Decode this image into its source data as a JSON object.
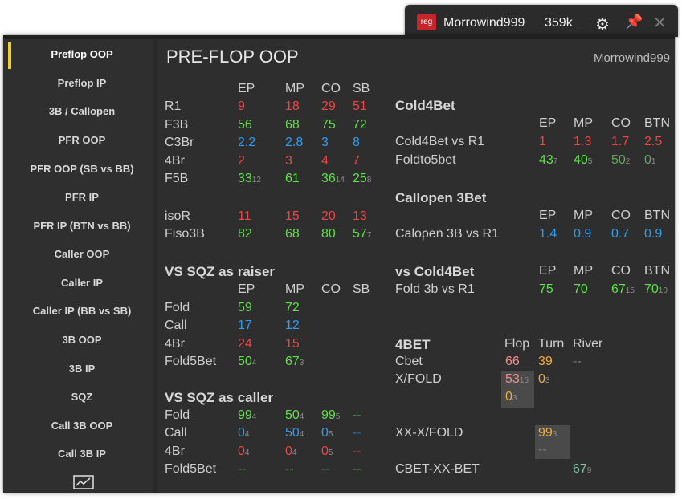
{
  "tab": {
    "logo": "reg",
    "user": "Morrowind999",
    "amount": "359k"
  },
  "sidebar": {
    "items": [
      "Preflop OOP",
      "Preflop IP",
      "3B / Callopen",
      "PFR OOP",
      "PFR OOP (SB vs BB)",
      "PFR IP",
      "PFR IP (BTN vs BB)",
      "Caller OOP",
      "Caller IP",
      "Caller IP (BB vs SB)",
      "3B OOP",
      "3B IP",
      "SQZ",
      "Call 3B OOP",
      "Call 3B IP"
    ]
  },
  "header": {
    "title": "PRE-FLOP OOP",
    "user_link": "Morrowind999"
  },
  "preflop": {
    "cols": [
      "EP",
      "MP",
      "CO",
      "SB"
    ],
    "rows": [
      {
        "label": "R1",
        "vals": [
          "9",
          "18",
          "29",
          "51"
        ]
      },
      {
        "label": "F3B",
        "vals": [
          "56",
          "68",
          "75",
          "72"
        ]
      },
      {
        "label": "C3Br",
        "vals": [
          "2.2",
          "2.8",
          "3",
          "8"
        ]
      },
      {
        "label": "4Br",
        "vals": [
          "2",
          "3",
          "4",
          "7"
        ]
      },
      {
        "label": "F5B",
        "vals": [
          "33",
          "61",
          "36",
          "25"
        ],
        "subs": [
          "12",
          "",
          "14",
          "8"
        ]
      },
      {
        "label": "isoR",
        "vals": [
          "11",
          "15",
          "20",
          "13"
        ]
      },
      {
        "label": "Fiso3B",
        "vals": [
          "82",
          "68",
          "80",
          "57"
        ],
        "subs": [
          "",
          "",
          "",
          "7"
        ]
      }
    ]
  },
  "sqz_raiser": {
    "title": "VS SQZ as raiser",
    "cols": [
      "EP",
      "MP",
      "CO",
      "SB"
    ],
    "rows": [
      {
        "label": "Fold",
        "vals": [
          "59",
          "72"
        ]
      },
      {
        "label": "Call",
        "vals": [
          "17",
          "12"
        ]
      },
      {
        "label": "4Br",
        "vals": [
          "24",
          "15"
        ]
      },
      {
        "label": "Fold5Bet",
        "vals": [
          "50",
          "67"
        ],
        "subs": [
          "4",
          "3"
        ]
      }
    ]
  },
  "sqz_caller": {
    "title": "VS SQZ as caller",
    "rows": [
      {
        "label": "Fold",
        "vals": [
          "99",
          "50",
          "99",
          "--"
        ],
        "subs": [
          "4",
          "4",
          "5",
          ""
        ]
      },
      {
        "label": "Call",
        "vals": [
          "0",
          "50",
          "0",
          "--"
        ],
        "subs": [
          "4",
          "4",
          "5",
          ""
        ]
      },
      {
        "label": "4Br",
        "vals": [
          "0",
          "0",
          "0",
          "--"
        ],
        "subs": [
          "4",
          "4",
          "5",
          ""
        ]
      },
      {
        "label": "Fold5Bet",
        "vals": [
          "--",
          "--",
          "--",
          "--"
        ]
      }
    ]
  },
  "cold4bet": {
    "title": "Cold4Bet",
    "cols": [
      "EP",
      "MP",
      "CO",
      "BTN"
    ],
    "rows": [
      {
        "label": "Cold4Bet vs R1",
        "vals": [
          "1",
          "1.3",
          "1.7",
          "2.5"
        ]
      },
      {
        "label": "Foldto5bet",
        "vals": [
          "43",
          "40",
          "50",
          "0"
        ],
        "subs": [
          "7",
          "5",
          "2",
          "1"
        ]
      }
    ]
  },
  "callopen": {
    "title": "Callopen 3Bet",
    "cols": [
      "EP",
      "MP",
      "CO",
      "BTN"
    ],
    "rows": [
      {
        "label": "Calopen 3B vs R1",
        "vals": [
          "1.4",
          "0.9",
          "0.7",
          "0.9"
        ]
      }
    ]
  },
  "vs_cold4bet": {
    "title": "vs Cold4Bet",
    "cols": [
      "EP",
      "MP",
      "CO",
      "BTN"
    ],
    "rows": [
      {
        "label": "Fold 3b vs R1",
        "vals": [
          "75",
          "70",
          "67",
          "70"
        ],
        "subs": [
          "",
          "",
          "15",
          "10"
        ]
      }
    ]
  },
  "fourbet": {
    "title": "4BET",
    "cols": [
      "Flop",
      "Turn",
      "River"
    ],
    "cbet": {
      "label": "Cbet",
      "vals": [
        "66",
        "39",
        "--"
      ]
    },
    "xfold": {
      "label": "X/FOLD",
      "flop": "53",
      "flop_sub": "15",
      "turn": "0",
      "turn_sub": "3",
      "flop2": "0",
      "flop2_sub": "3"
    },
    "xxxfold": {
      "label": "XX-X/FOLD",
      "turn": "99",
      "turn_sub": "3",
      "turn2": "--"
    },
    "cbetxxbet": {
      "label": "CBET-XX-BET",
      "river": "67",
      "river_sub": "9"
    }
  }
}
